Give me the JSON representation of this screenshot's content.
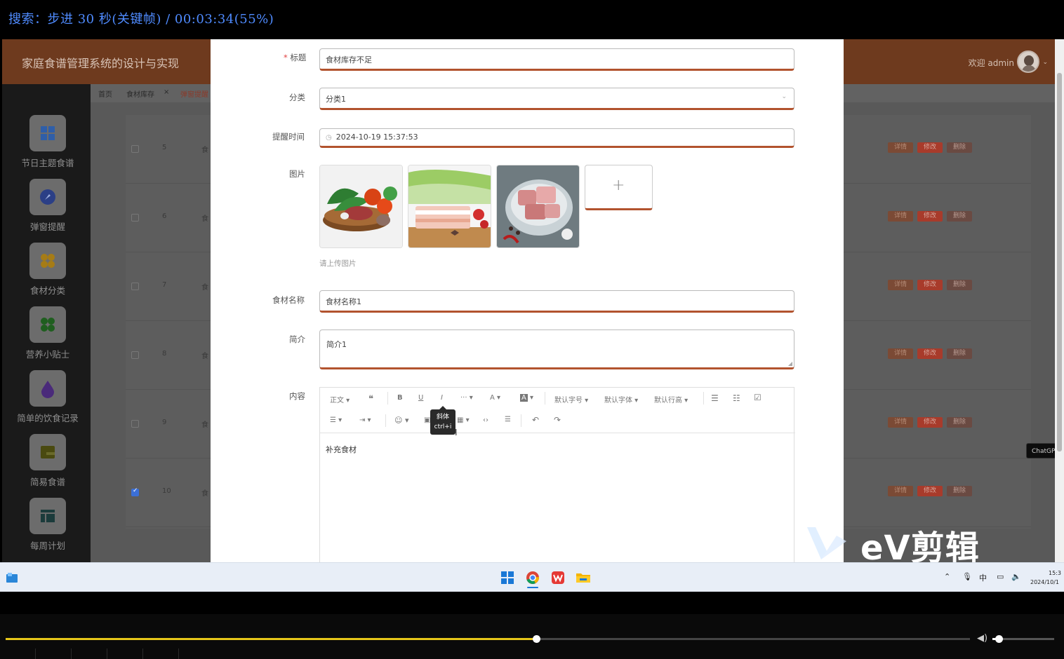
{
  "player": {
    "banner_text": "搜索：步进 30 秒(关键帧) / 00:03:34(55%)",
    "progress_percent": 55,
    "volume_percent": 10
  },
  "app": {
    "title": "家庭食谱管理系统的设计与实现",
    "welcome": "欢迎 admin",
    "sidebar": {
      "items": [
        {
          "label": "节日主题食谱",
          "icon": "grid-icon"
        },
        {
          "label": "弹窗提醒",
          "icon": "compass-icon"
        },
        {
          "label": "食材分类",
          "icon": "four-dots-icon"
        },
        {
          "label": "营养小贴士",
          "icon": "four-dots-green-icon"
        },
        {
          "label": "简单的饮食记录",
          "icon": "drop-icon"
        },
        {
          "label": "简易食谱",
          "icon": "wallet-icon"
        },
        {
          "label": "每周计划",
          "icon": "layout-icon"
        }
      ]
    },
    "tabs": [
      {
        "label": "首页"
      },
      {
        "label": "食材库存",
        "close": "×"
      },
      {
        "label": "弹窗提醒"
      }
    ],
    "table": {
      "rows": [
        {
          "num": "5",
          "text": "食",
          "checked": false
        },
        {
          "num": "6",
          "text": "食",
          "checked": false
        },
        {
          "num": "7",
          "text": "食",
          "checked": false
        },
        {
          "num": "8",
          "text": "食",
          "checked": false
        },
        {
          "num": "9",
          "text": "食",
          "checked": false
        },
        {
          "num": "10",
          "text": "食",
          "checked": true
        }
      ],
      "actions": {
        "detail": "详情",
        "edit": "修改",
        "delete": "删除"
      }
    },
    "chatgpt_tab": "ChatGP"
  },
  "form": {
    "title_label": "标题",
    "title_required_mark": "*",
    "title_value": "食材库存不足",
    "category_label": "分类",
    "category_value": "分类1",
    "remind_time_label": "提醒时间",
    "remind_time_value": "2024-10-19 15:37:53",
    "image_label": "图片",
    "upload_hint": "请上传图片",
    "ingredient_name_label": "食材名称",
    "ingredient_name_value": "食材名称1",
    "intro_label": "简介",
    "intro_value": "简介1",
    "content_label": "内容",
    "editor": {
      "toolbar_row1": [
        "正文",
        "❝",
        "B",
        "U",
        "I",
        "···",
        "A",
        "A",
        "默认字号",
        "默认字体",
        "默认行高"
      ],
      "tooltip_title": "斜体",
      "tooltip_shortcut": "ctrl+i",
      "body_text": "补充食材"
    }
  },
  "watermark": {
    "text": "eV剪辑"
  },
  "taskbar": {
    "ime": "中",
    "time": "15:3",
    "date": "2024/10/1"
  }
}
